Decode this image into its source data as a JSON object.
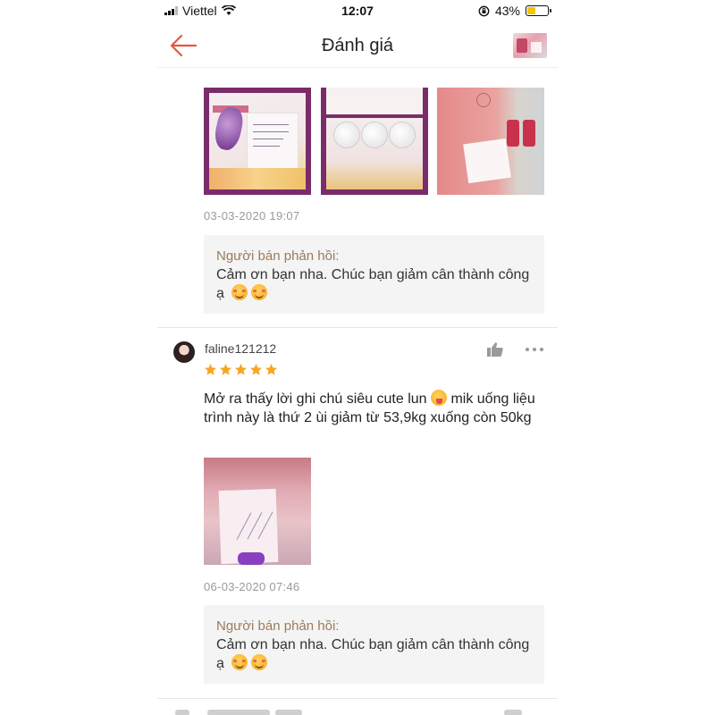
{
  "status_bar": {
    "carrier": "Viettel",
    "time": "12:07",
    "battery_percent": "43%",
    "battery_level": 0.43,
    "battery_color": "#f5c30a"
  },
  "header": {
    "title": "Đánh giá",
    "back_icon": "arrow-left-icon",
    "accent_color": "#e8573a"
  },
  "reviews": [
    {
      "photo_count": 3,
      "date": "03-03-2020 19:07",
      "seller_reply": {
        "label": "Người bán phản hồi:",
        "text": "Cảm ơn bạn nha. Chúc bạn giảm cân thành công ạ"
      }
    },
    {
      "username": "faline121212",
      "rating": 5,
      "star_color": "#f6a623",
      "text_part1": "Mở ra thấy lời ghi chú siêu cute lun",
      "text_part2": " mik uống liệu trình này là thứ 2 ùi giảm từ 53,9kg xuống còn 50kg",
      "photo_count": 1,
      "date": "06-03-2020 07:46",
      "seller_reply": {
        "label": "Người bán phản hồi:",
        "text": "Cảm ơn bạn nha. Chúc bạn giảm cân thành công ạ"
      }
    }
  ]
}
